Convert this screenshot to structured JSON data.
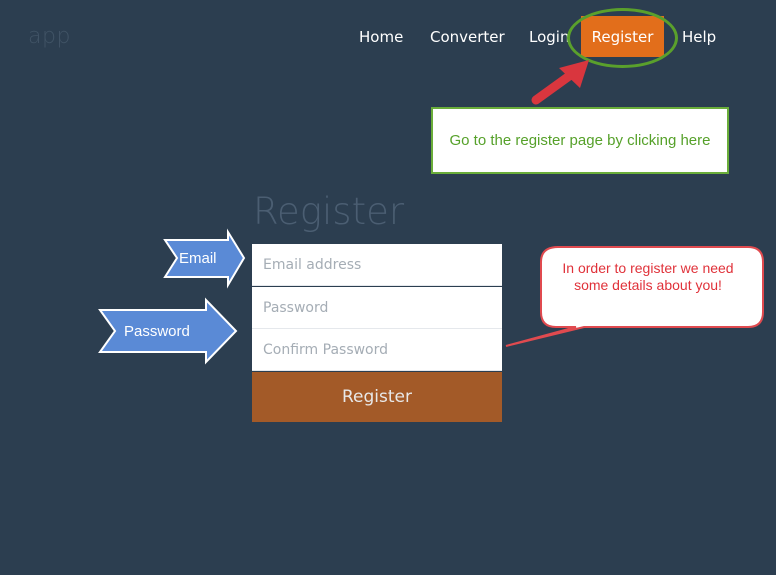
{
  "brand": "app",
  "nav": {
    "home": "Home",
    "converter": "Converter",
    "login": "Login",
    "register": "Register",
    "help": "Help"
  },
  "annotations": {
    "register_hint": "Go to the register page by clicking here",
    "email_arrow": "Email",
    "password_arrow": "Password",
    "details_bubble": "In order to register we need some details about you!"
  },
  "form": {
    "title": "Register",
    "email_placeholder": "Email address",
    "password_placeholder": "Password",
    "confirm_placeholder": "Confirm Password",
    "submit_label": "Register"
  },
  "colors": {
    "background": "#2c3e50",
    "nav_active": "#e26e1b",
    "submit": "#a35a28",
    "hint_green": "#56a12a",
    "arrow_blue": "#5a8ad6",
    "callout_red": "#e0323a"
  }
}
